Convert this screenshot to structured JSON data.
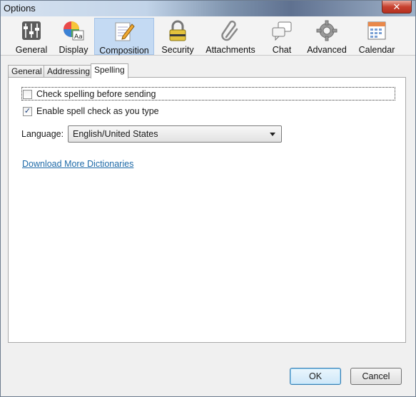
{
  "window": {
    "title": "Options",
    "close_label": "✕"
  },
  "toolbar": {
    "items": [
      {
        "label": "General",
        "icon": "sliders-icon"
      },
      {
        "label": "Display",
        "icon": "display-palette-icon"
      },
      {
        "label": "Composition",
        "icon": "pencil-notepad-icon",
        "active": true
      },
      {
        "label": "Security",
        "icon": "padlock-icon"
      },
      {
        "label": "Attachments",
        "icon": "paperclip-icon"
      },
      {
        "label": "Chat",
        "icon": "chat-bubbles-icon"
      },
      {
        "label": "Advanced",
        "icon": "gear-icon"
      },
      {
        "label": "Calendar",
        "icon": "calendar-icon"
      }
    ]
  },
  "tabs": [
    {
      "label": "General"
    },
    {
      "label": "Addressing"
    },
    {
      "label": "Spelling",
      "active": true
    }
  ],
  "spelling": {
    "check_before_sending": {
      "label": "Check spelling before sending",
      "checked": false
    },
    "spell_as_you_type": {
      "label": "Enable spell check as you type",
      "checked": true,
      "mark": "✓"
    },
    "language_label": "Language:",
    "language_value": "English/United States",
    "download_link": "Download More Dictionaries"
  },
  "buttons": {
    "ok": "OK",
    "cancel": "Cancel"
  },
  "colors": {
    "active_tab_bg": "#c4daf3",
    "link": "#1e6aa8",
    "close_red": "#c7412f"
  }
}
